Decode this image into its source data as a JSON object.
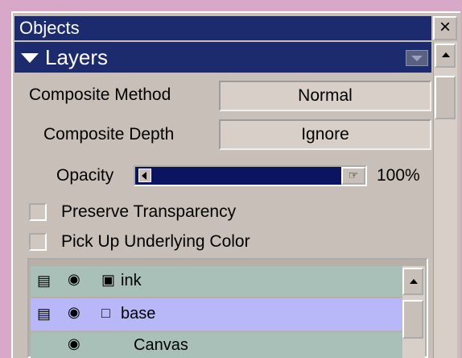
{
  "window": {
    "title": "Objects",
    "close_glyph": "×"
  },
  "section": {
    "label": "Layers"
  },
  "composite_method": {
    "label": "Composite Method",
    "value": "Normal"
  },
  "composite_depth": {
    "label": "Composite Depth",
    "value": "Ignore"
  },
  "opacity": {
    "label": "Opacity",
    "value_text": "100%",
    "level": 1.0
  },
  "checkboxes": [
    {
      "label": "Preserve Transparency",
      "checked": false
    },
    {
      "label": "Pick Up Underlying Color",
      "checked": false
    }
  ],
  "layers": [
    {
      "name": "ink",
      "lock_icon": "lock-closed-icon",
      "selected": false
    },
    {
      "name": "base",
      "lock_icon": "lock-open-icon",
      "selected": true
    },
    {
      "name": "Canvas",
      "lock_icon": "",
      "selected": false
    }
  ],
  "colors": {
    "titlebar": "#1c2a6e",
    "panel": "#c8c0b8",
    "row_default": "#a8c0b8",
    "row_selected": "#b8b8f8",
    "background": "#d8a8c8"
  }
}
